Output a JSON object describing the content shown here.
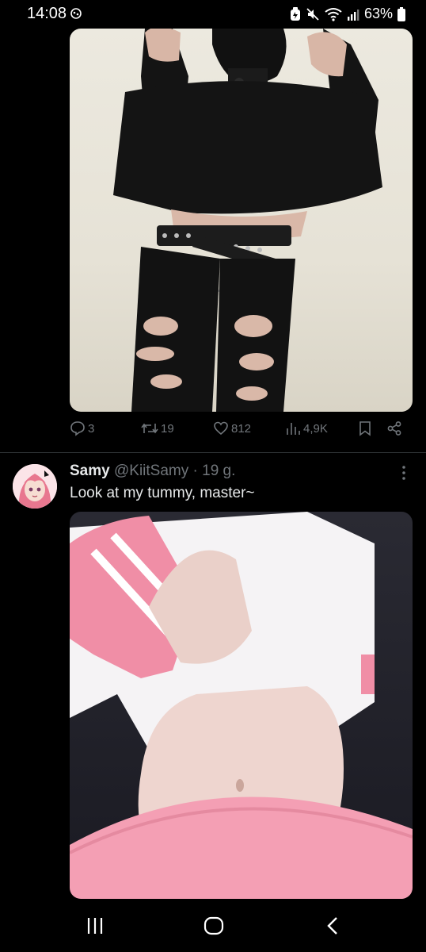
{
  "status_bar": {
    "time": "14:08",
    "battery": "63%",
    "icons": [
      "gallery-notification-icon",
      "saver-icon",
      "mute-icon",
      "wifi-icon",
      "signal-icon",
      "battery-icon"
    ]
  },
  "tweet1": {
    "actions": {
      "replies": "3",
      "retweets": "19",
      "likes": "812",
      "views": "4,9K"
    }
  },
  "tweet2": {
    "name": "Samy",
    "handle": "@KiitSamy",
    "separator": "·",
    "time": "19 g.",
    "text": "Look at my tummy, master~"
  },
  "nav_bar": {
    "icons": [
      "recent-apps-icon",
      "home-icon",
      "back-icon"
    ]
  },
  "colors": {
    "background": "#000000",
    "text": "#e7e9ea",
    "muted": "#71767b",
    "divider": "#2f3336"
  }
}
